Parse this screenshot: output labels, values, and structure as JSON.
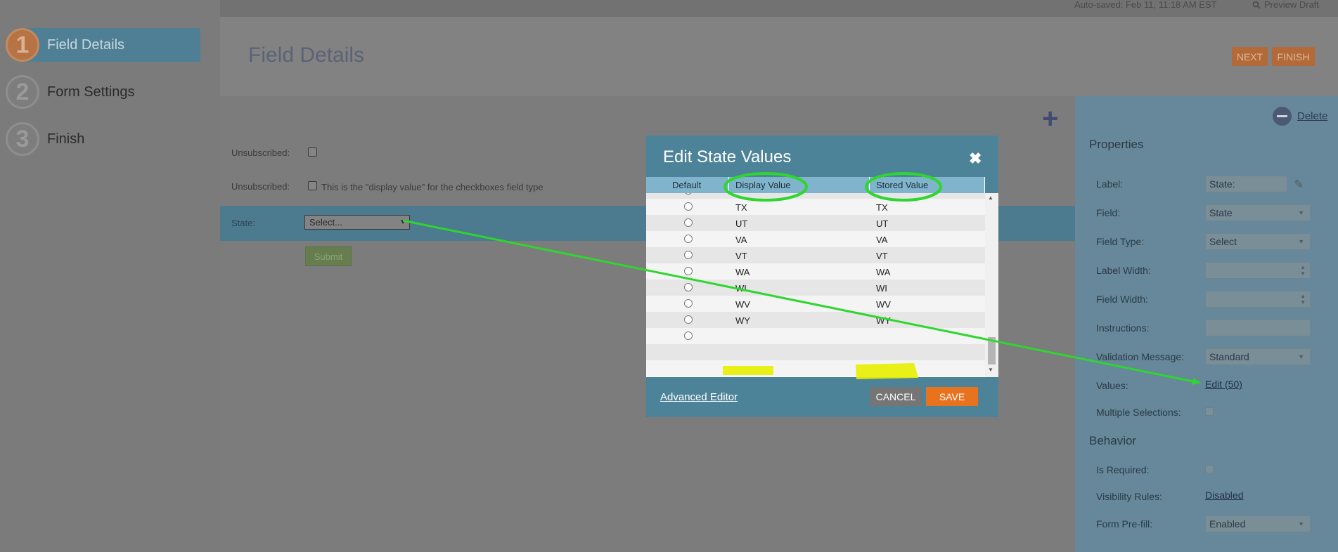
{
  "topbar": {
    "autosave": "Auto-saved: Feb 11, 11:18 AM EST",
    "preview": "Preview Draft",
    "preview_icon": "magnifier-icon"
  },
  "wizard": {
    "steps": [
      {
        "number": "1",
        "label": "Field Details"
      },
      {
        "number": "2",
        "label": "Form Settings"
      },
      {
        "number": "3",
        "label": "Finish"
      }
    ]
  },
  "header": {
    "title": "Field Details",
    "next_label": "NEXT",
    "finish_label": "FINISH"
  },
  "form": {
    "unsub1_label": "Unsubscribed:",
    "unsub2_label": "Unsubscribed:",
    "unsub2_text": "This is the \"display value\" for the checkboxes field type",
    "state_label": "State:",
    "state_select": "Select...",
    "submit_label": "Submit",
    "add_icon": "plus-icon"
  },
  "properties": {
    "delete_label": "Delete",
    "section_properties": "Properties",
    "section_behavior": "Behavior",
    "label_label": "Label:",
    "label_value": "State:",
    "field_label": "Field:",
    "field_value": "State",
    "field_type_label": "Field Type:",
    "field_type_value": "Select",
    "label_width_label": "Label Width:",
    "field_width_label": "Field Width:",
    "instructions_label": "Instructions:",
    "validation_label": "Validation Message:",
    "validation_value": "Standard",
    "values_label": "Values:",
    "values_link": "Edit (50)",
    "multiple_label": "Multiple Selections:",
    "required_label": "Is Required:",
    "visibility_label": "Visibility Rules:",
    "visibility_value": "Disabled",
    "prefill_label": "Form Pre-fill:",
    "prefill_value": "Enabled"
  },
  "modal": {
    "title": "Edit State Values",
    "close_icon": "close-icon",
    "columns": {
      "default": "Default",
      "display": "Display Value",
      "stored": "Stored Value"
    },
    "rows": [
      {
        "display": "TX",
        "stored": "TX"
      },
      {
        "display": "UT",
        "stored": "UT"
      },
      {
        "display": "VA",
        "stored": "VA"
      },
      {
        "display": "VT",
        "stored": "VT"
      },
      {
        "display": "WA",
        "stored": "WA"
      },
      {
        "display": "WI",
        "stored": "WI"
      },
      {
        "display": "WV",
        "stored": "WV"
      },
      {
        "display": "WY",
        "stored": "WY"
      },
      {
        "display": "",
        "stored": ""
      }
    ],
    "advanced_editor": "Advanced Editor",
    "cancel_label": "CANCEL",
    "save_label": "SAVE"
  },
  "annotation_colors": {
    "circle": "#2fd62f",
    "arrow": "#2fd62f",
    "highlight": "#e8f000"
  }
}
